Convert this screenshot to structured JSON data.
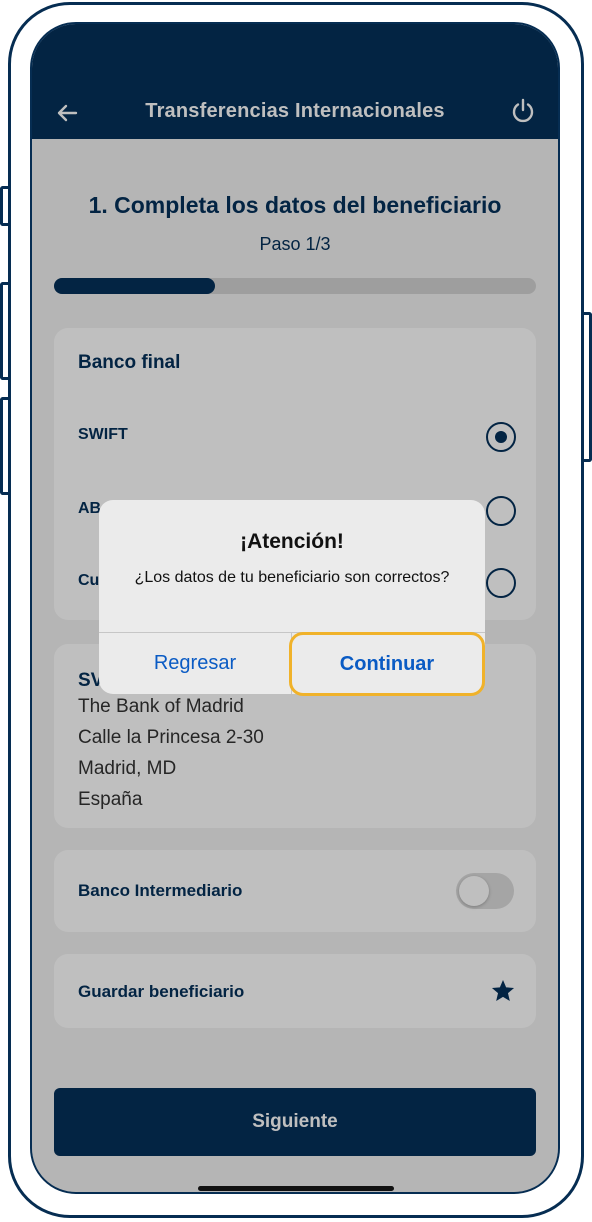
{
  "header": {
    "title": "Transferencias Internacionales",
    "back_icon": "arrow-left-icon",
    "power_icon": "power-icon",
    "background": "#04305a"
  },
  "step": {
    "title": "1. Completa los datos del beneficiario",
    "subtitle": "Paso 1/3",
    "progress_fraction": 0.333
  },
  "bank_card": {
    "title": "Banco final",
    "options": [
      {
        "label": "SWIFT",
        "selected": true
      },
      {
        "label": "AB",
        "selected": false
      },
      {
        "label": "Cu",
        "selected": false
      }
    ]
  },
  "address_card": {
    "heading": "SV",
    "lines": [
      "The Bank of Madrid",
      "Calle la Princesa 2-30",
      "Madrid, MD",
      "España"
    ]
  },
  "intermediary": {
    "label": "Banco Intermediario",
    "enabled": false
  },
  "save_beneficiary": {
    "label": "Guardar beneficiario",
    "icon": "star-icon"
  },
  "primary_button": {
    "label": "Siguiente"
  },
  "dialog": {
    "title": "¡Atención!",
    "message": "¿Los datos de tu beneficiario son correctos?",
    "cancel_label": "Regresar",
    "confirm_label": "Continuar",
    "highlight_color": "#f0b22a",
    "link_color": "#0a5bc4"
  }
}
